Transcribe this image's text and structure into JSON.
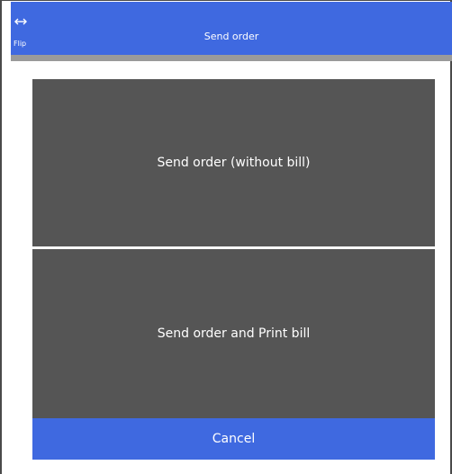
{
  "header": {
    "title": "Send order",
    "flip_label": "Flip",
    "flip_icon": "horizontal-arrows-icon",
    "color": "#3f69e0"
  },
  "options": [
    {
      "label": "Send order (without bill)"
    },
    {
      "label": "Send order and Print bill"
    }
  ],
  "cancel_label": "Cancel",
  "colors": {
    "option_bg": "#555555",
    "accent": "#3f69e0"
  }
}
